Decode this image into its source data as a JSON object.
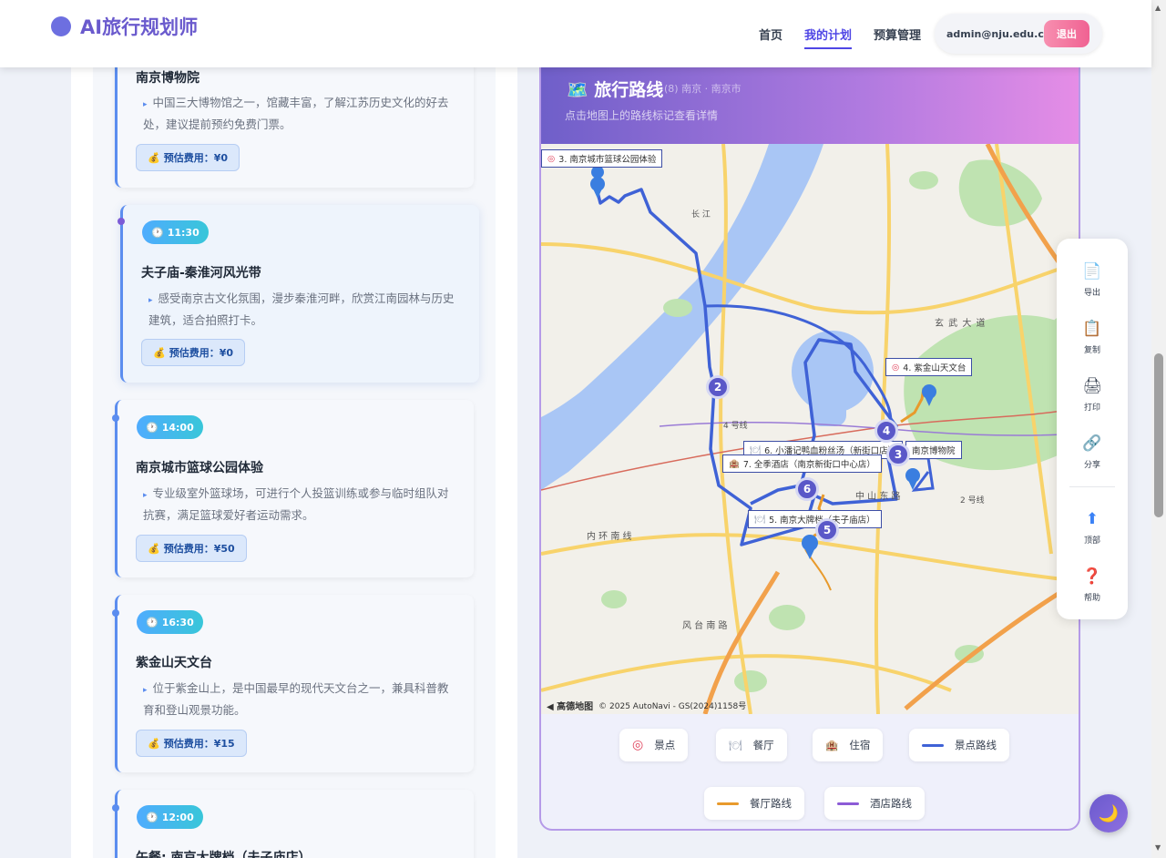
{
  "header": {
    "brand": "AI旅行规划师",
    "nav": [
      "首页",
      "我的计划",
      "预算管理"
    ],
    "active_nav": "我的计划",
    "user_email": "admin@nju.edu.cn",
    "logout": "退出"
  },
  "itinerary": [
    {
      "time": "",
      "title": "南京博物院",
      "desc": "中国三大博物馆之一，馆藏丰富，了解江苏历史文化的好去处，建议提前预约免费门票。",
      "cost": "预估费用：¥0"
    },
    {
      "time": "11:30",
      "title": "夫子庙-秦淮河风光带",
      "desc": "感受南京古文化氛围，漫步秦淮河畔，欣赏江南园林与历史建筑，适合拍照打卡。",
      "cost": "预估费用：¥0"
    },
    {
      "time": "14:00",
      "title": "南京城市篮球公园体验",
      "desc": "专业级室外篮球场，可进行个人投篮训练或参与临时组队对抗赛，满足篮球爱好者运动需求。",
      "cost": "预估费用：¥50"
    },
    {
      "time": "16:30",
      "title": "紫金山天文台",
      "desc": "位于紫金山上，是中国最早的现代天文台之一，兼具科普教育和登山观景功能。",
      "cost": "预估费用：¥15"
    },
    {
      "time": "12:00",
      "title": "午餐: 南京大牌档（夫子庙店）",
      "desc": "",
      "cost": ""
    }
  ],
  "map": {
    "title": "旅行路线",
    "subtitle": "(8) 南京 · 南京市",
    "hint": "点击地图上的路线标记查看详情",
    "labels": [
      "3. 南京城市篮球公园体验",
      "4. 紫金山天文台",
      "6. 小潘记鸭血粉丝汤（新街口店）",
      "南京博物院",
      "7. 全季酒店（南京新街口中心店）",
      "5. 南京大牌档（夫子庙店）"
    ],
    "marker_numbers": [
      "2",
      "4",
      "3",
      "6",
      "5"
    ],
    "place_labels": [
      "玄 武 大 道",
      "4 号线",
      "中 山 东 路",
      "2 号线",
      "内 环 南 线",
      "风 台 南 路",
      "长 江"
    ],
    "copyright": "© 2025 AutoNavi - GS(2024)1158号",
    "logo": "高德地图"
  },
  "legend": [
    {
      "label": "景点",
      "icon": "target-icon",
      "color": "#e0435c"
    },
    {
      "label": "餐厅",
      "icon": "fork-knife-icon",
      "color": "#9aa3b5"
    },
    {
      "label": "住宿",
      "icon": "hotel-icon",
      "color": "#c0483d"
    },
    {
      "label": "景点路线",
      "color": "#3f62d6"
    },
    {
      "label": "餐厅路线",
      "color": "#e89a2c"
    },
    {
      "label": "酒店路线",
      "color": "#8c5bd6"
    }
  ],
  "tools": [
    "导出",
    "复制",
    "打印",
    "分享",
    "顶部",
    "帮助"
  ],
  "theme_toggle": "🌙"
}
